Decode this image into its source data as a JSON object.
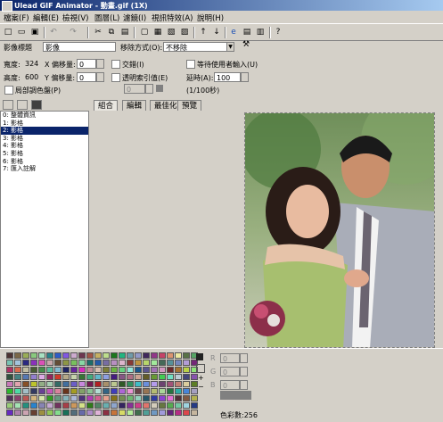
{
  "window": {
    "title": "Ulead GIF Animator - 動畫.gif (1X)"
  },
  "menu": [
    "檔案(F)",
    "編輯(E)",
    "檢視(V)",
    "圖層(L)",
    "濾鏡(I)",
    "視訊特效(A)",
    "說明(H)"
  ],
  "properties": {
    "image_title_label": "影像標題",
    "image_title_value": "影像",
    "remove_method_label": "移除方式(O):",
    "remove_method_value": "不移除",
    "width_label": "寬度:",
    "width_value": "324",
    "height_label": "高度:",
    "height_value": "600",
    "x_offset_label": "X 偏移量:",
    "x_offset_value": "0",
    "y_offset_label": "Y 偏移量:",
    "y_offset_value": "0",
    "local_palette_label": "局部調色盤(P)",
    "interlace_label": "交錯(I)",
    "transparent_index_label": "透明索引值(E)",
    "transparent_index_value": "0",
    "wait_user_label": "等待使用者輸入(U)",
    "delay_label": "延時(A):",
    "delay_value": "100",
    "delay_unit": "(1/100秒)"
  },
  "tabs": [
    "組合",
    "編輯",
    "最佳化",
    "預覽"
  ],
  "frames": [
    "0: 整體資訊",
    "1: 影格",
    "2: 影格",
    "3: 影格",
    "4: 影格",
    "5: 影格",
    "6: 影格",
    "7: 匯入註解"
  ],
  "selected_frame": 2,
  "palette": {
    "colors_label": "色彩數:256",
    "r": "0",
    "g": "0",
    "b": "0"
  }
}
